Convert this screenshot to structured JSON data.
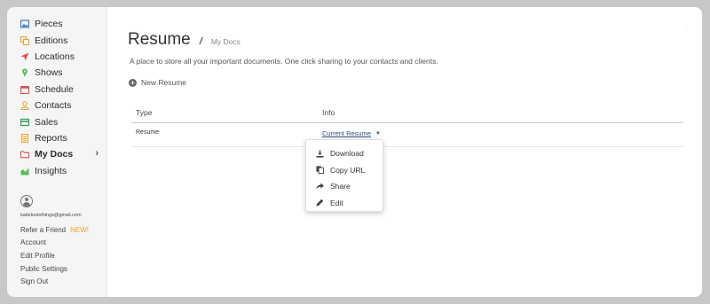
{
  "sidebar": {
    "items": [
      {
        "label": "Pieces",
        "icon": "image-icon",
        "color": "#3a7bbf"
      },
      {
        "label": "Editions",
        "icon": "editions-icon",
        "color": "#e8a33c"
      },
      {
        "label": "Locations",
        "icon": "location-arrow-icon",
        "color": "#d9534f"
      },
      {
        "label": "Shows",
        "icon": "map-pin-icon",
        "color": "#5cb85c"
      },
      {
        "label": "Schedule",
        "icon": "calendar-icon",
        "color": "#d9534f"
      },
      {
        "label": "Contacts",
        "icon": "person-icon",
        "color": "#e8a33c"
      },
      {
        "label": "Sales",
        "icon": "credit-card-icon",
        "color": "#2e9a5a"
      },
      {
        "label": "Reports",
        "icon": "report-icon",
        "color": "#e8a33c"
      },
      {
        "label": "My Docs",
        "icon": "folder-icon",
        "color": "#d9534f"
      },
      {
        "label": "Insights",
        "icon": "chart-icon",
        "color": "#5cb85c"
      }
    ],
    "active_item": "My Docs",
    "email": "katieteststhings@gmail.com",
    "account_links": {
      "refer": "Refer a Friend",
      "refer_badge": "NEW!",
      "account": "Account",
      "edit_profile": "Edit Profile",
      "public_settings": "Public Settings",
      "sign_out": "Sign Out"
    }
  },
  "main": {
    "title": "Resume",
    "breadcrumb_sep": "/",
    "breadcrumb": "My Docs",
    "description": "A place to store all your important documents. One click sharing to your contacts and clients.",
    "new_button": "New Resume",
    "table": {
      "headers": [
        "Type",
        "Info"
      ],
      "rows": [
        {
          "type": "Resume",
          "info": "Current Resume"
        }
      ]
    },
    "dropdown": {
      "items": [
        {
          "label": "Download",
          "icon": "download-icon"
        },
        {
          "label": "Copy URL",
          "icon": "copy-icon"
        },
        {
          "label": "Share",
          "icon": "share-icon"
        },
        {
          "label": "Edit",
          "icon": "pencil-icon"
        }
      ]
    }
  }
}
